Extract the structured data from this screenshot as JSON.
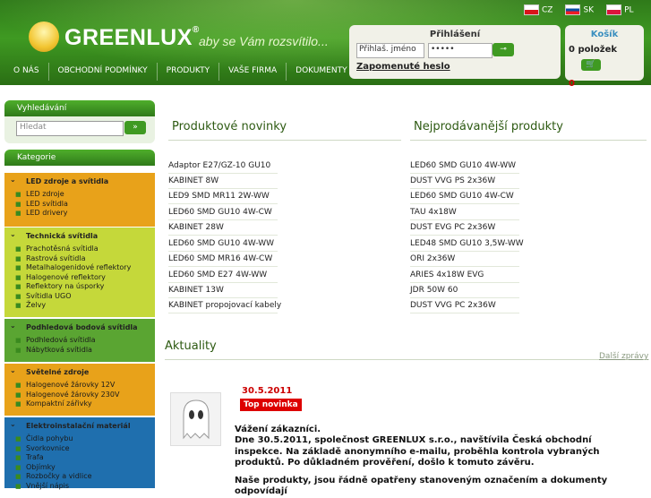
{
  "header": {
    "logo_text": "GREENLUX",
    "logo_reg": "®",
    "slogan": "aby se Vám rozsvítilo...",
    "nav": [
      "O NÁS",
      "OBCHODNÍ PODMÍNKY",
      "PRODUKTY",
      "VAŠE FIRMA",
      "DOKUMENTY"
    ],
    "languages": [
      {
        "code": "CZ",
        "flag": "cz-flag-icon"
      },
      {
        "code": "SK",
        "flag": "sk-flag-icon"
      },
      {
        "code": "PL",
        "flag": "pl-flag-icon"
      }
    ]
  },
  "login": {
    "title": "Přihlášení",
    "username_value": "Přihlaš. jméno",
    "password_value": "•••••",
    "submit_icon": "key-icon",
    "forgot_label": "Zapomenuté heslo"
  },
  "cart": {
    "title": "Košík",
    "count_label": "0 položek",
    "cart_icon": "cart-icon",
    "total": "0"
  },
  "sidebar": {
    "search_title": "Vyhledávání",
    "search_placeholder": "Hledat",
    "search_button": "»",
    "categories_title": "Kategorie",
    "categories": [
      {
        "title": "LED zdroje a svítidla",
        "color": "#e8a21a",
        "items": [
          "LED zdroje",
          "LED svítidla",
          "LED drivery"
        ]
      },
      {
        "title": "Technická svítidla",
        "color": "#c5d83a",
        "items": [
          "Prachotěsná svítidla",
          "Rastrová svítidla",
          "Metalhalogenidové reflektory",
          "Halogenové reflektory",
          "Reflektory na úsporky",
          "Svítidla UGO",
          "Želvy"
        ]
      },
      {
        "title": "Podhledová bodová svítidla",
        "color": "#5aa532",
        "items": [
          "Podhledová svítidla",
          "Nábytková svítidla"
        ]
      },
      {
        "title": "Světelné zdroje",
        "color": "#e8a21a",
        "items": [
          "Halogenové žárovky 12V",
          "Halogenové žárovky 230V",
          "Kompaktní zářivky"
        ]
      },
      {
        "title": "Elektroinstalační materiál",
        "color": "#1f6fae",
        "items": [
          "Čidla pohybu",
          "Svorkovnice",
          "Trafa",
          "Objímky",
          "Rozbočky a vidlice",
          "Vnější nápis"
        ]
      }
    ]
  },
  "main": {
    "new_products_title": "Produktové novinky",
    "best_sellers_title": "Nejprodávanější produkty",
    "new_products": [
      "Adaptor E27/GZ-10 GU10",
      "KABINET 8W",
      "LED9 SMD MR11 2W-WW",
      "LED60 SMD GU10 4W-CW",
      "KABINET 28W",
      "LED60 SMD GU10 4W-WW",
      "LED60 SMD MR16 4W-CW",
      "LED60 SMD E27 4W-WW",
      "KABINET 13W",
      "KABINET propojovací kabely"
    ],
    "best_sellers": [
      "LED60 SMD GU10 4W-WW",
      "DUST VVG PS 2x36W",
      "LED60 SMD GU10 4W-CW",
      "TAU 4x18W",
      "DUST EVG PC 2x36W",
      "LED48 SMD GU10 3,5W-WW",
      "ORI 2x36W",
      "ARIES 4x18W EVG",
      "JDR 50W 60",
      "DUST VVG PC 2x36W"
    ],
    "news_title": "Aktuality",
    "more_news": "Další zprávy",
    "news": {
      "date": "30.5.2011",
      "badge": "Top novinka",
      "greeting": "Vážení zákazníci.",
      "body": "Dne 30.5.2011, společnost GREENLUX s.r.o., navštívila Česká obchodní inspekce. Na základě anonymního e-mailu, proběhla kontrola vybraných produktů. Po důkladném prověření, došlo k tomuto závěru.",
      "body2": "Naše produkty, jsou řádně opatřeny stanoveným označením a dokumenty odpovídají"
    }
  }
}
